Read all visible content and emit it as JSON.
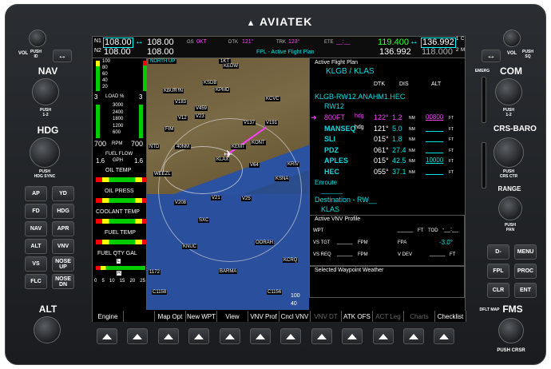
{
  "brand": "AVIATEK",
  "left": {
    "vol": "VOL",
    "push_id": "PUSH\nID",
    "nav": "NAV",
    "push12": "PUSH\n1-2",
    "hdg": "HDG",
    "hdg_sync": "PUSH\nHDG SYNC",
    "alt": "ALT",
    "keys": [
      "AP",
      "YD",
      "FD",
      "HDG",
      "NAV",
      "APR",
      "ALT",
      "VNV",
      "VS",
      "NOSE UP",
      "FLC",
      "NOSE DN"
    ]
  },
  "right": {
    "vol": "VOL",
    "push_sq": "PUSH\nSQ",
    "emerg": "EMERG",
    "com": "COM",
    "push12": "PUSH\n1-2",
    "crs_baro": "CRS-BARO",
    "push_crs": "PUSH\nCRS CTR",
    "range": "RANGE",
    "push_pan": "PUSH\nPAN",
    "keys": [
      "D-",
      "MENU",
      "FPL",
      "PROC",
      "CLR",
      "ENT"
    ],
    "dflt_map": "DFLT MAP",
    "fms": "FMS",
    "push_crsr": "PUSH CRSR"
  },
  "nav_radio": {
    "n1": "N1",
    "n2": "N2",
    "a1": "108.00",
    "b1": "108.00",
    "a2": "108.00",
    "b2": "108.00"
  },
  "top_bar": {
    "gs_label": "GS",
    "gs": "0KT",
    "dtk_label": "DTK",
    "dtk": "121°",
    "trk_label": "TRK",
    "trk": "123°",
    "ete_label": "ETE",
    "ete": "__:__",
    "fpl_title": "FPL - Active Flight Plan"
  },
  "com_radio": {
    "active": "119.400",
    "standby": "136.992",
    "c1": "1",
    "c2": "2",
    "row2a": "136.992",
    "row2b": "118.000",
    "cm": "C",
    "mm": "M"
  },
  "eis": {
    "rpm_ticks": [
      "100",
      "80",
      "60",
      "40",
      "20"
    ],
    "load": "3",
    "load_label": "LOAD %",
    "load_r": "3",
    "ff_ticks": [
      "3000",
      "2400",
      "1800",
      "1200",
      "600"
    ],
    "rpm_val": "700",
    "rpm_label": "RPM",
    "rpm_r": "700",
    "fuel_flow": "FUEL FLOW",
    "ff_l": "1.6",
    "ff_unit": "GPH",
    "ff_r": "1.6",
    "oil_temp": "OIL TEMP",
    "oil_press": "OIL PRESS",
    "coolant": "COOLANT TEMP",
    "fuel_temp": "FUEL TEMP",
    "fuel_qty": "FUEL QTY GAL",
    "l": "L",
    "r": "R",
    "qty_ticks": [
      "0",
      "5",
      "10",
      "15",
      "20",
      "25"
    ]
  },
  "map": {
    "north_up": "NORTH UP",
    "alt_1kt": "1KT",
    "range_top": "100",
    "range_bot": "40",
    "scale": "40NM",
    "labels": [
      "KEDW",
      "KPMD",
      "KCVC",
      "V137",
      "V459",
      "KSDB",
      "V191",
      "V12",
      "V23",
      "V183",
      "KEMT",
      "KONT",
      "KRIV",
      "KLAX",
      "KSNA",
      "V64",
      "V208",
      "V21",
      "V25",
      "KNUC",
      "SXC",
      "BARMA",
      "C1156",
      "C1158",
      "OORAH",
      "KCRQ",
      "NTD",
      "FIM",
      "WEEZL",
      "GMN",
      "KBUR",
      "1172"
    ]
  },
  "fpl": {
    "title": "Active Flight Plan",
    "route": "KLGB / KLAS",
    "cols": [
      "DTK",
      "DIS",
      "ALT"
    ],
    "name": "KLGB-RW12.ANAHM1.HEC",
    "rw": "RW12",
    "rows": [
      {
        "wpt": "800FT",
        "mode": "hdg",
        "dtk": "122°",
        "dis": "1.2",
        "u": "NM",
        "alt": "00800",
        "au": "FT"
      },
      {
        "wpt": "MANSEQ",
        "mode": "hdg",
        "dtk": "121°",
        "dis": "5.0",
        "u": "NM",
        "alt": "_____",
        "au": "FT"
      },
      {
        "wpt": "SLI",
        "mode": "",
        "dtk": "015°",
        "dis": "1.8",
        "u": "NM",
        "alt": "_____",
        "au": "FT"
      },
      {
        "wpt": "PDZ",
        "mode": "",
        "dtk": "061°",
        "dis": "27.4",
        "u": "NM",
        "alt": "_____",
        "au": "FT"
      },
      {
        "wpt": "APLES",
        "mode": "",
        "dtk": "015°",
        "dis": "42.5",
        "u": "NM",
        "alt": "10000",
        "au": "FT"
      },
      {
        "wpt": "HEC",
        "mode": "",
        "dtk": "055°",
        "dis": "37.1",
        "u": "NM",
        "alt": "_____",
        "au": "FT"
      }
    ],
    "enroute": "Enroute",
    "dest_label": "Destination - RW__",
    "dest": "KLAS"
  },
  "vnv": {
    "title": "Active VNV Profile",
    "wpt": "WPT",
    "wpt_v": "_____",
    "ft": "FT",
    "tod": "TOD",
    "tod_v": "-__:__",
    "vs_tgt": "VS TGT",
    "fpm": "FPM",
    "fpa": "FPA",
    "fpa_v": "-3.0°",
    "vs_req": "VS REQ",
    "v_dev": "V DEV",
    "dash": "_____"
  },
  "wx": {
    "title": "Selected Waypoint Weather"
  },
  "softkeys": [
    "Engine",
    "",
    "Map Opt",
    "New WPT",
    "View",
    "VNV Prof",
    "Cncl VNV",
    "VNV DT",
    "ATK OFS",
    "ACT Leg",
    "Charts",
    "Checklist"
  ],
  "softkey_disabled": [
    7,
    9,
    10
  ],
  "colors": {
    "cyan": "#00e0e0",
    "magenta": "#ff3dff",
    "green": "#33ff33",
    "bezel": "#222"
  }
}
